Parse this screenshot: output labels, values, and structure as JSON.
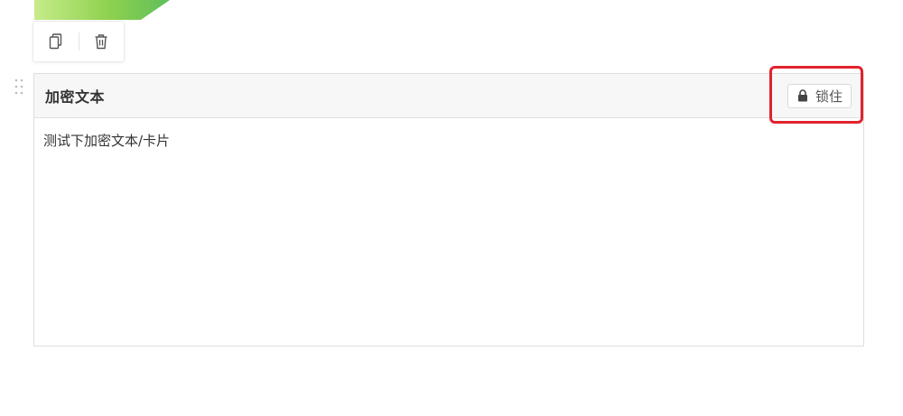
{
  "card": {
    "title": "加密文本",
    "content": "测试下加密文本/卡片",
    "lock_button_label": "锁住"
  },
  "icons": {
    "copy": "copy-icon",
    "delete": "trash-icon",
    "lock": "lock-icon",
    "drag": "drag-handle-icon"
  },
  "colors": {
    "annotation": "#e0232e",
    "banner_green": "#8fd14f",
    "header_bg": "#f7f7f7"
  }
}
